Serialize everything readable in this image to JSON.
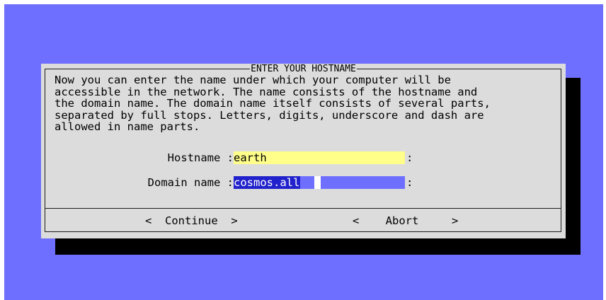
{
  "dialog": {
    "title": "ENTER YOUR HOSTNAME",
    "description_lines": [
      "Now you can enter the name under which your computer will be",
      "accessible in the network. The name consists of the hostname and",
      "the domain name. The domain name itself consists of several parts,",
      "separated by full stops. Letters, digits, underscore and dash are",
      "allowed in name parts."
    ],
    "hostname": {
      "label": "Hostname :",
      "value": "earth",
      "suffix": ":"
    },
    "domain": {
      "label": "Domain name :",
      "value": "cosmos.all",
      "suffix": ":"
    },
    "buttons": {
      "continue": "<  Continue  >",
      "abort": "<    Abort     >"
    }
  },
  "colors": {
    "screen_background": "#6f6fff",
    "dialog_background": "#dcdcdc",
    "shadow": "#000000",
    "hostname_field": "#ffff8a",
    "domain_field_active": "#6f6fff",
    "domain_text_highlight": "#2222cc"
  }
}
